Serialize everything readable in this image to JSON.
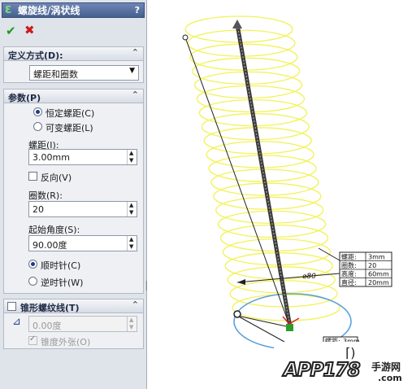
{
  "panel": {
    "title": "螺旋线/涡状线",
    "help": "?",
    "ok_icon": "✔",
    "cancel_icon": "✖",
    "definition_group": {
      "header": "定义方式(D):",
      "collapse_icon": "chevron-up-icon",
      "selected": "螺距和圈数"
    },
    "params_group": {
      "header": "参数(P)",
      "constant_pitch": "恒定螺距(C)",
      "variable_pitch": "可变螺距(L)",
      "pitch_label": "螺距(I):",
      "pitch_value": "3.00mm",
      "reverse_label": "反向(V)",
      "revolutions_label": "圈数(R):",
      "revolutions_value": "20",
      "start_angle_label": "起始角度(S):",
      "start_angle_value": "90.00度",
      "clockwise": "顺时针(C)",
      "counterclockwise": "逆时针(W)"
    },
    "taper_group": {
      "header": "锥形螺纹线(T)",
      "taper_value": "0.00度",
      "taper_outward": "锥度外张(O)"
    }
  },
  "viewport": {
    "dimension_diameter": "⌀80",
    "callout": {
      "rows": [
        {
          "label": "螺距:",
          "value": "3mm"
        },
        {
          "label": "圈数:",
          "value": "20"
        },
        {
          "label": "高度:",
          "value": "60mm"
        },
        {
          "label": "直径:",
          "value": "20mm"
        }
      ]
    },
    "callout2": {
      "label": "螺距:",
      "value": "3mm"
    }
  },
  "watermark": {
    "logo": "APP178",
    "cn": "手游网",
    "com": ".com"
  },
  "colors": {
    "helix": "#f2f25a",
    "axis": "#3a3a3a",
    "circle": "#5aa0dd"
  }
}
